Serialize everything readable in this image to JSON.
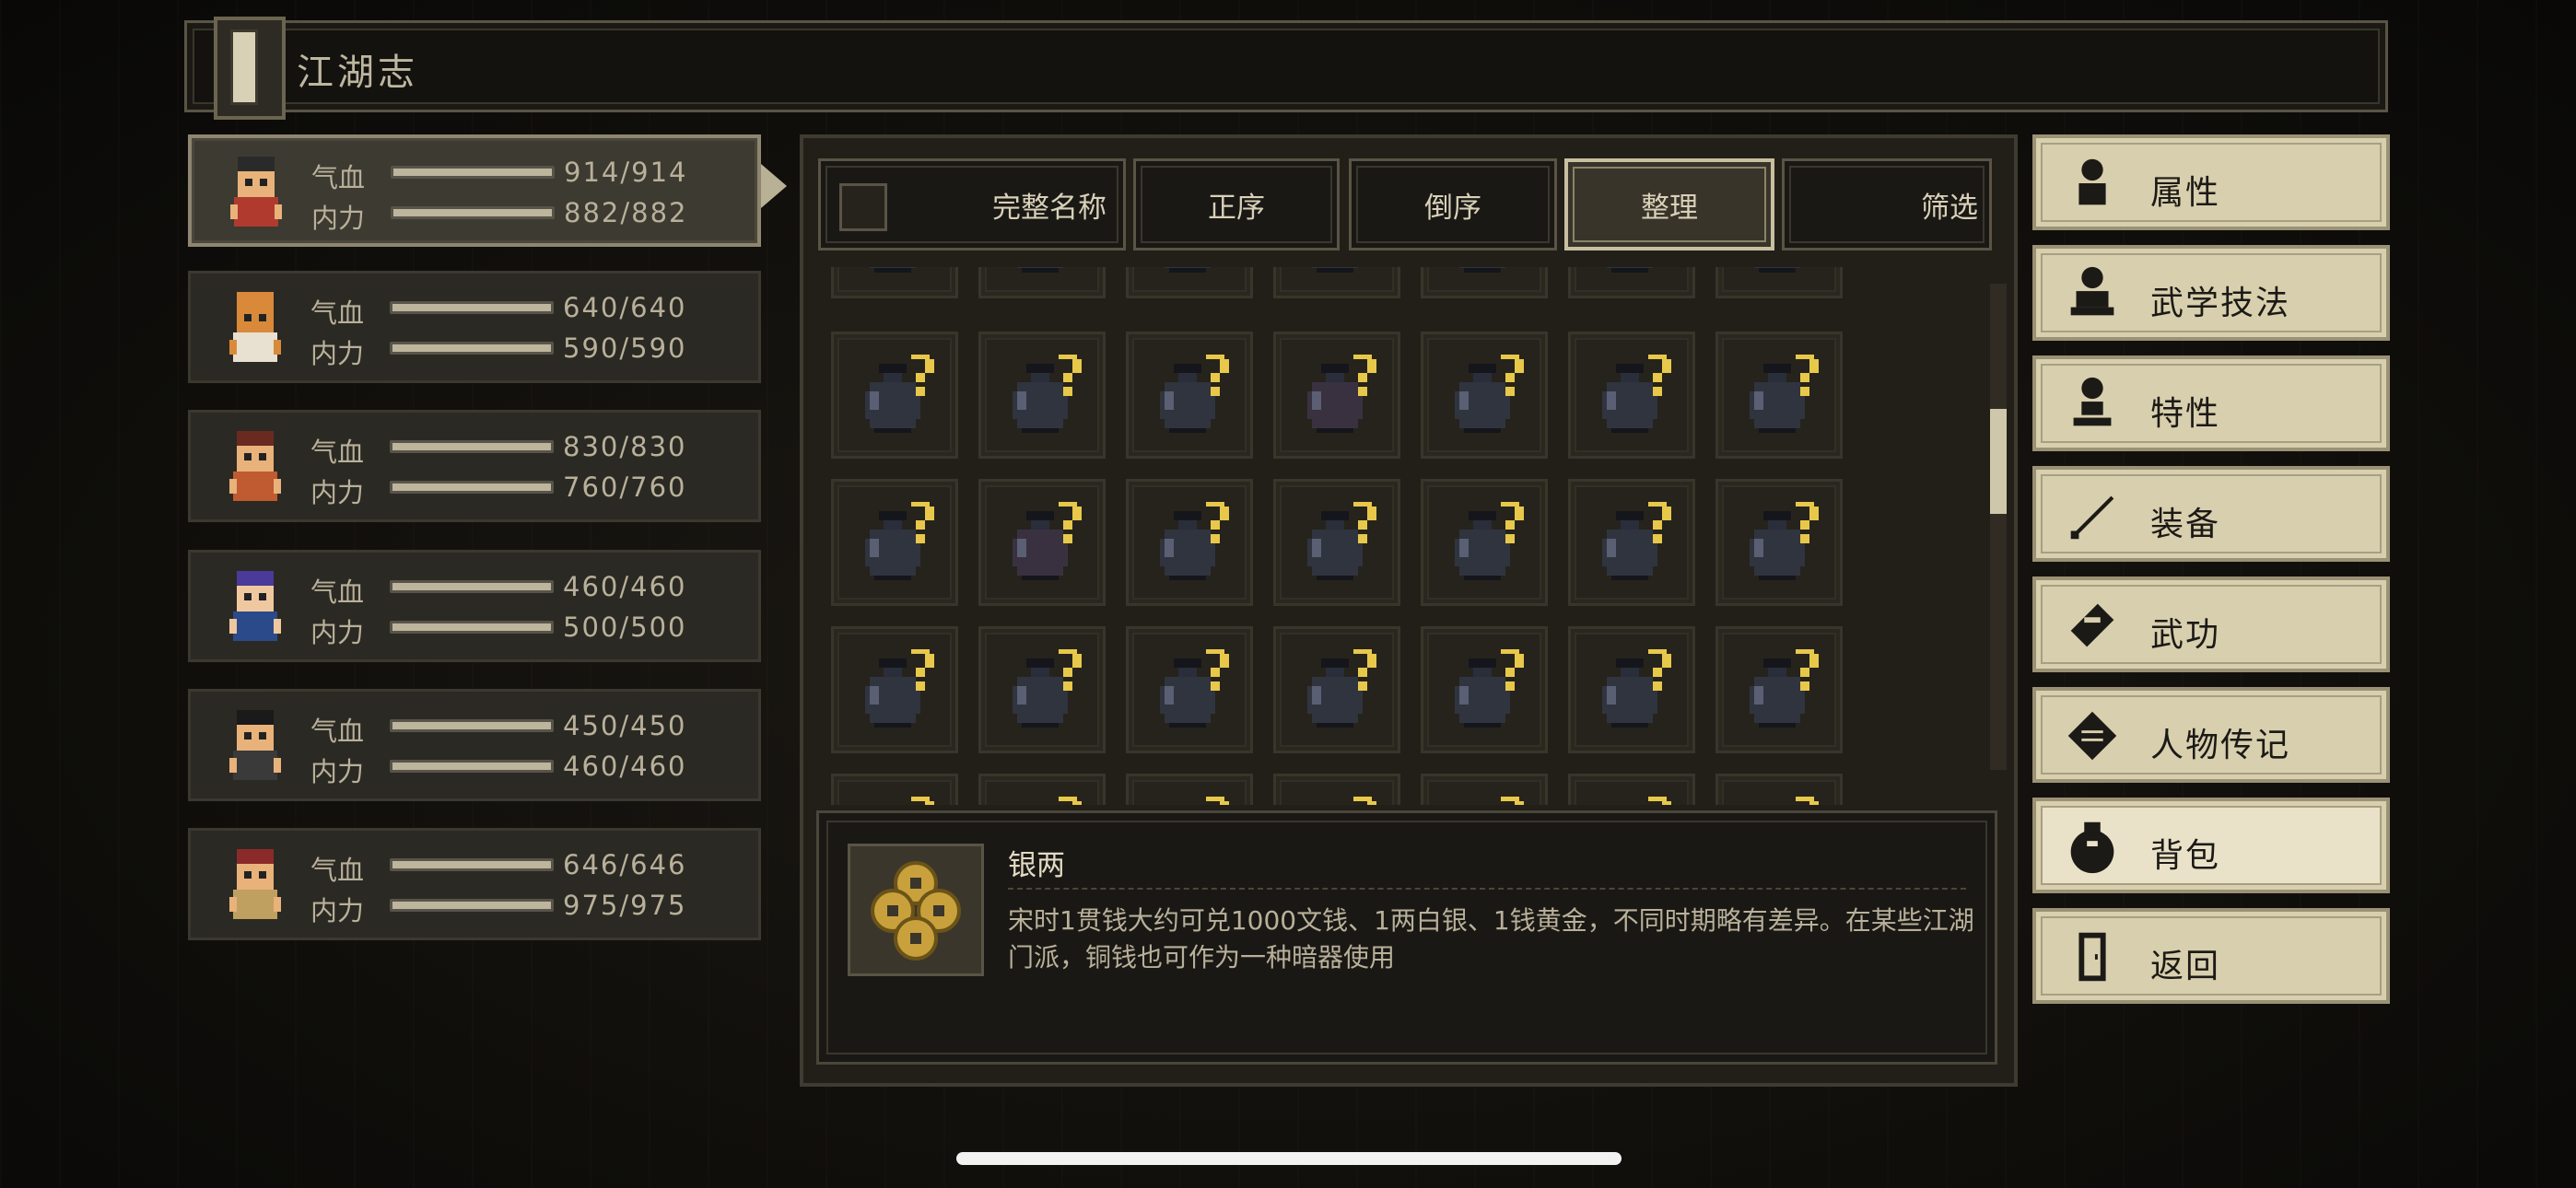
{
  "header": {
    "title": "江湖志",
    "book_icon": "book-icon"
  },
  "party": [
    {
      "hp_label": "气血",
      "mp_label": "内力",
      "hp": "914/914",
      "mp": "882/882",
      "selected": true
    },
    {
      "hp_label": "气血",
      "mp_label": "内力",
      "hp": "640/640",
      "mp": "590/590"
    },
    {
      "hp_label": "气血",
      "mp_label": "内力",
      "hp": "830/830",
      "mp": "760/760"
    },
    {
      "hp_label": "气血",
      "mp_label": "内力",
      "hp": "460/460",
      "mp": "500/500"
    },
    {
      "hp_label": "气血",
      "mp_label": "内力",
      "hp": "450/450",
      "mp": "460/460"
    },
    {
      "hp_label": "气血",
      "mp_label": "内力",
      "hp": "646/646",
      "mp": "975/975"
    }
  ],
  "toolbar": {
    "full_name": "完整名称",
    "ascending": "正序",
    "descending": "倒序",
    "organize": "整理",
    "filter": "筛选"
  },
  "inventory": {
    "slot_icon": "unknown-jar-icon",
    "unknown_mark": "?"
  },
  "detail": {
    "name": "银两",
    "description": "宋时1贯钱大约可兑1000文钱、1两白银、1钱黄金，不同时期略有差异。在某些江湖门派，铜钱也可作为一种暗器使用",
    "icon": "coins-icon"
  },
  "menu": [
    {
      "label": "属性",
      "icon": "person-icon"
    },
    {
      "label": "武学技法",
      "icon": "meditate-icon"
    },
    {
      "label": "特性",
      "icon": "trait-icon"
    },
    {
      "label": "装备",
      "icon": "sword-icon"
    },
    {
      "label": "武功",
      "icon": "scroll-icon"
    },
    {
      "label": "人物传记",
      "icon": "book-icon"
    },
    {
      "label": "背包",
      "icon": "bag-icon",
      "active": true
    },
    {
      "label": "返回",
      "icon": "door-icon"
    }
  ],
  "colors": {
    "panel": "#221f19",
    "menu": "#d8cfae",
    "accent": "#c7bf9f",
    "question": "#e8c84a"
  }
}
